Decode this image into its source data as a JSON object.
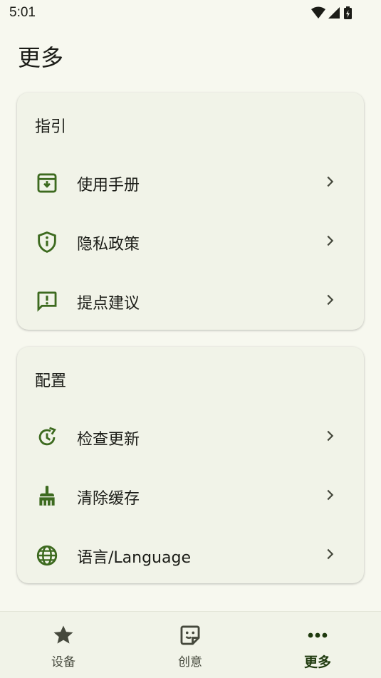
{
  "status_bar": {
    "time": "5:01"
  },
  "page": {
    "title": "更多"
  },
  "sections": [
    {
      "title": "指引",
      "items": [
        {
          "label": "使用手册",
          "icon": "manual-download-icon"
        },
        {
          "label": "隐私政策",
          "icon": "privacy-shield-icon"
        },
        {
          "label": "提点建议",
          "icon": "feedback-icon"
        }
      ]
    },
    {
      "title": "配置",
      "items": [
        {
          "label": "检查更新",
          "icon": "update-icon"
        },
        {
          "label": "清除缓存",
          "icon": "broom-icon"
        },
        {
          "label": "语言/Language",
          "icon": "globe-icon"
        }
      ]
    }
  ],
  "bottom_nav": {
    "items": [
      {
        "label": "设备",
        "icon": "star-icon"
      },
      {
        "label": "创意",
        "icon": "sticker-icon"
      },
      {
        "label": "更多",
        "icon": "more-horiz-icon",
        "active": true
      }
    ]
  },
  "colors": {
    "accent": "#3d6a1f",
    "background": "#f7f8ef",
    "card": "#f1f3e8"
  }
}
